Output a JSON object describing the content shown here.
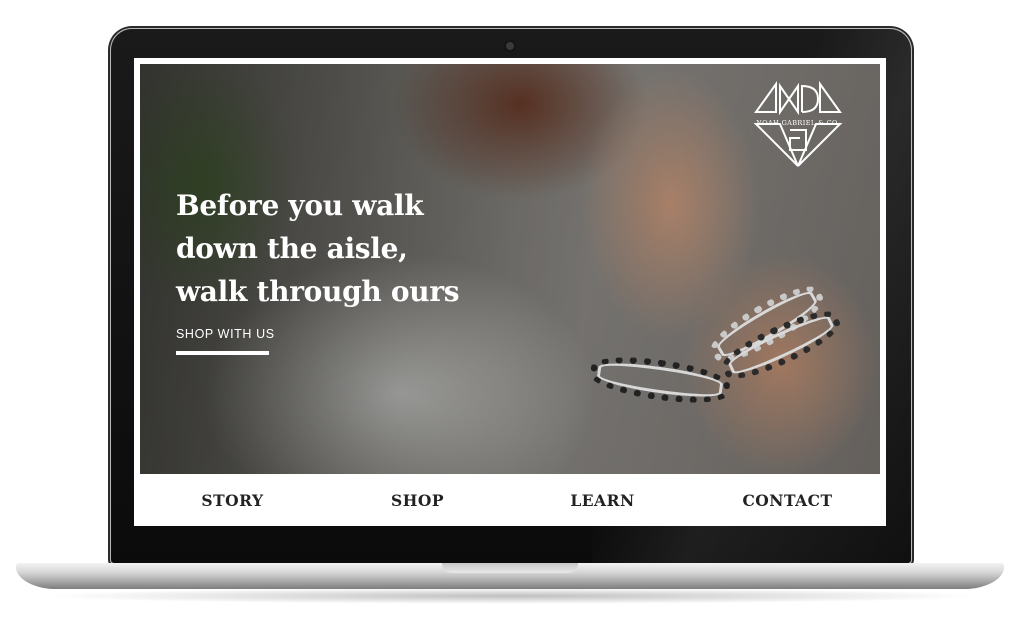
{
  "hero": {
    "headline": "Before you walk down the aisle, walk through ours",
    "cta_label": "SHOP WITH US"
  },
  "logo": {
    "text": "NOAH GABRIEL & CO."
  },
  "nav": {
    "items": [
      {
        "label": "STORY"
      },
      {
        "label": "SHOP"
      },
      {
        "label": "LEARN"
      },
      {
        "label": "CONTACT"
      }
    ]
  },
  "colors": {
    "text_on_image": "#ffffff",
    "nav_text": "#222222",
    "device_frame": "#111111"
  },
  "icons": [
    "brand-logo-icon",
    "camera-icon"
  ]
}
